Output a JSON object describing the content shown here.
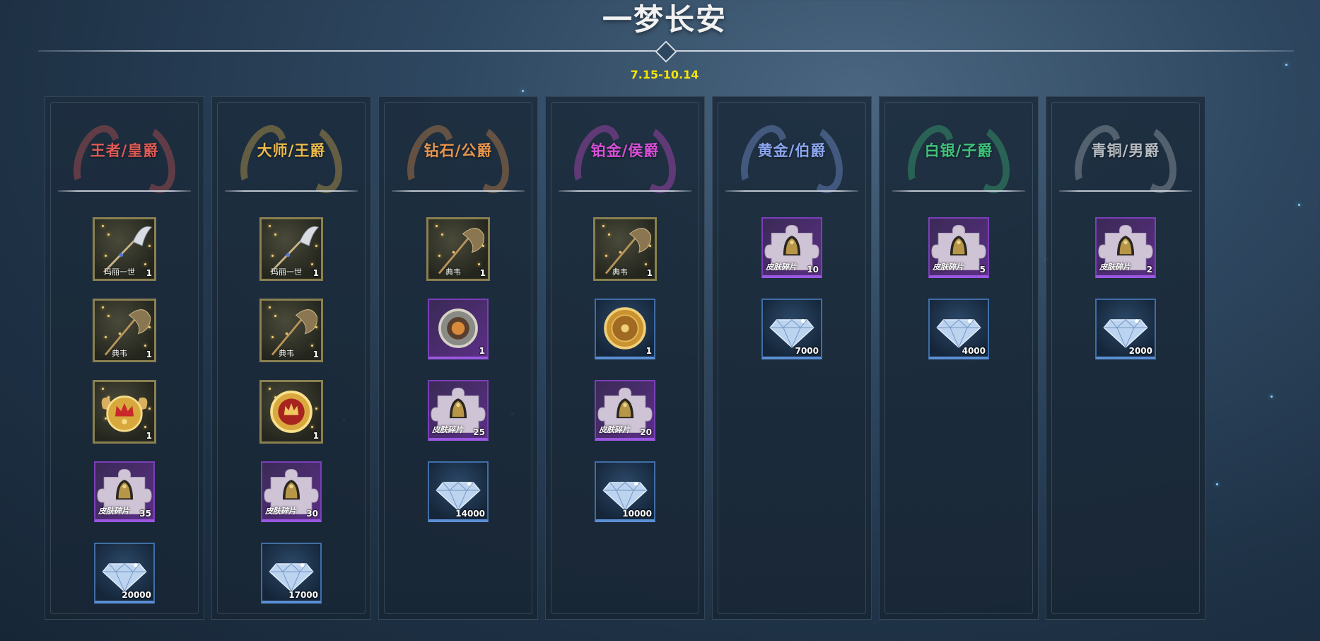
{
  "title": "一梦长安",
  "date_range": "7.15-10.14",
  "colors": {
    "date": "#f5e400",
    "title": "#f2f2f2"
  },
  "columns": [
    {
      "rank": "王者/皇爵",
      "color": "#e05a55",
      "items": [
        {
          "icon": "glaive-weapon-icon",
          "frame": "gold",
          "name": "玛丽一世",
          "count": "1"
        },
        {
          "icon": "axe-weapon-icon",
          "frame": "gold",
          "name": "典韦",
          "count": "1"
        },
        {
          "icon": "crown-badge-icon",
          "frame": "gold",
          "name": "",
          "count": "1"
        },
        {
          "icon": "skin-fragment-icon",
          "frame": "purple",
          "name": "皮肤碎片",
          "count": "35"
        },
        {
          "icon": "diamond-icon",
          "frame": "blue",
          "name": "",
          "count": "20000"
        }
      ]
    },
    {
      "rank": "大师/王爵",
      "color": "#e8b84a",
      "items": [
        {
          "icon": "glaive-weapon-icon",
          "frame": "gold",
          "name": "玛丽一世",
          "count": "1"
        },
        {
          "icon": "axe-weapon-icon",
          "frame": "gold",
          "name": "典韦",
          "count": "1"
        },
        {
          "icon": "crown-medal-icon",
          "frame": "gold",
          "name": "",
          "count": "1"
        },
        {
          "icon": "skin-fragment-icon",
          "frame": "purple",
          "name": "皮肤碎片",
          "count": "30"
        },
        {
          "icon": "diamond-icon",
          "frame": "blue",
          "name": "",
          "count": "17000"
        }
      ]
    },
    {
      "rank": "钻石/公爵",
      "color": "#e8944a",
      "items": [
        {
          "icon": "axe-weapon-icon",
          "frame": "gold",
          "name": "典韦",
          "count": "1"
        },
        {
          "icon": "shield-emblem-icon",
          "frame": "purple",
          "name": "",
          "count": "1"
        },
        {
          "icon": "skin-fragment-icon",
          "frame": "purple",
          "name": "皮肤碎片",
          "count": "25"
        },
        {
          "icon": "diamond-icon",
          "frame": "blue",
          "name": "",
          "count": "14000"
        }
      ]
    },
    {
      "rank": "铂金/侯爵",
      "color": "#d94fd8",
      "items": [
        {
          "icon": "axe-weapon-icon",
          "frame": "gold",
          "name": "典韦",
          "count": "1"
        },
        {
          "icon": "gold-shield-icon",
          "frame": "blue",
          "name": "",
          "count": "1"
        },
        {
          "icon": "skin-fragment-icon",
          "frame": "purple",
          "name": "皮肤碎片",
          "count": "20"
        },
        {
          "icon": "diamond-icon",
          "frame": "blue",
          "name": "",
          "count": "10000"
        }
      ]
    },
    {
      "rank": "黄金/伯爵",
      "color": "#8aa6ef",
      "items": [
        {
          "icon": "skin-fragment-icon",
          "frame": "purple",
          "name": "皮肤碎片",
          "count": "10"
        },
        {
          "icon": "diamond-icon",
          "frame": "blue",
          "name": "",
          "count": "7000"
        }
      ]
    },
    {
      "rank": "白银/子爵",
      "color": "#3fc27a",
      "items": [
        {
          "icon": "skin-fragment-icon",
          "frame": "purple",
          "name": "皮肤碎片",
          "count": "5"
        },
        {
          "icon": "diamond-icon",
          "frame": "blue",
          "name": "",
          "count": "4000"
        }
      ]
    },
    {
      "rank": "青铜/男爵",
      "color": "#b7bcc2",
      "items": [
        {
          "icon": "skin-fragment-icon",
          "frame": "purple",
          "name": "皮肤碎片",
          "count": "2"
        },
        {
          "icon": "diamond-icon",
          "frame": "blue",
          "name": "",
          "count": "2000"
        }
      ]
    }
  ]
}
